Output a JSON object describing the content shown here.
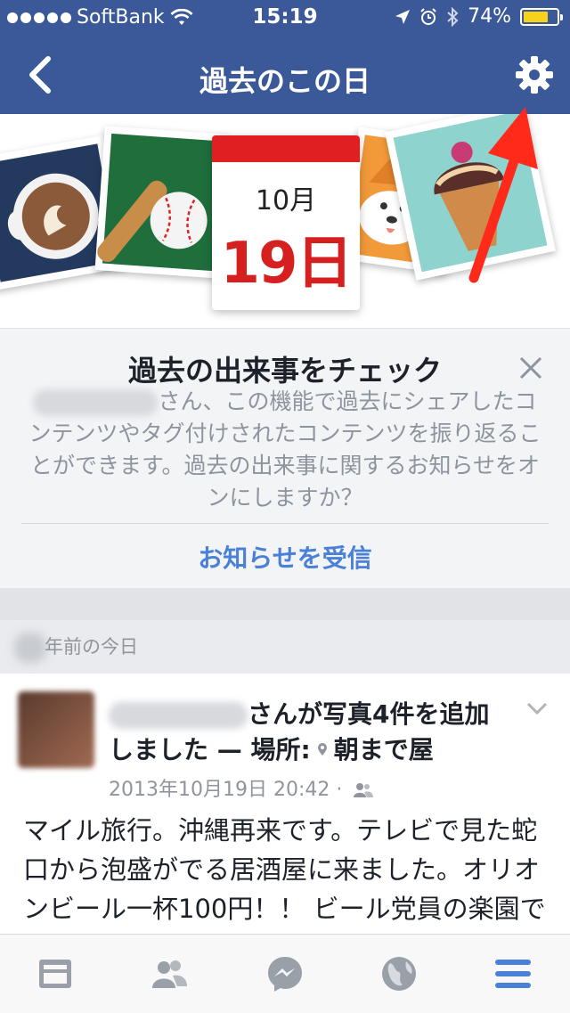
{
  "status_bar": {
    "carrier": "SoftBank",
    "time": "15:19",
    "battery": "74%",
    "battery_level": 0.74,
    "icons": [
      "wifi-icon",
      "location-arrow-icon",
      "alarm-clock-icon",
      "bluetooth-icon",
      "battery-icon"
    ]
  },
  "nav": {
    "title": "過去のこの日",
    "back_icon": "chevron-left-icon",
    "settings_icon": "gear-icon"
  },
  "banner": {
    "month": "10月",
    "day": "19日"
  },
  "card": {
    "title": "過去の出来事をチェック",
    "body": "さん、この機能で過去にシェアしたコンテンツやタグ付けされたコンテンツを振り返ることができます。過去の出来事に関するお知らせをオンにしますか？",
    "action": "お知らせを受信"
  },
  "section": {
    "label": "年前の今日"
  },
  "post": {
    "header_suffix": "さんが写真4件を追加しました — 場所:",
    "place": "朝まで屋",
    "timestamp": "2013年10月19日 20:42",
    "separator": "·",
    "text": "マイル旅行。沖縄再来です。テレビで見た蛇口から泡盛がでる居酒屋に来ました。オリオンビール一杯100円！！ ビール党員の楽園ですね！あとで、泡盛を挑戦します。"
  },
  "tab_bar": {
    "tabs": [
      "news-feed-icon",
      "friends-icon",
      "messenger-icon",
      "globe-icon",
      "menu-icon"
    ],
    "active_color": "#4a80d8"
  },
  "colors": {
    "brand": "#3b5998",
    "link": "#4a80d8",
    "calendar_red": "#d62020",
    "annotation_arrow": "#ff2a1a"
  }
}
